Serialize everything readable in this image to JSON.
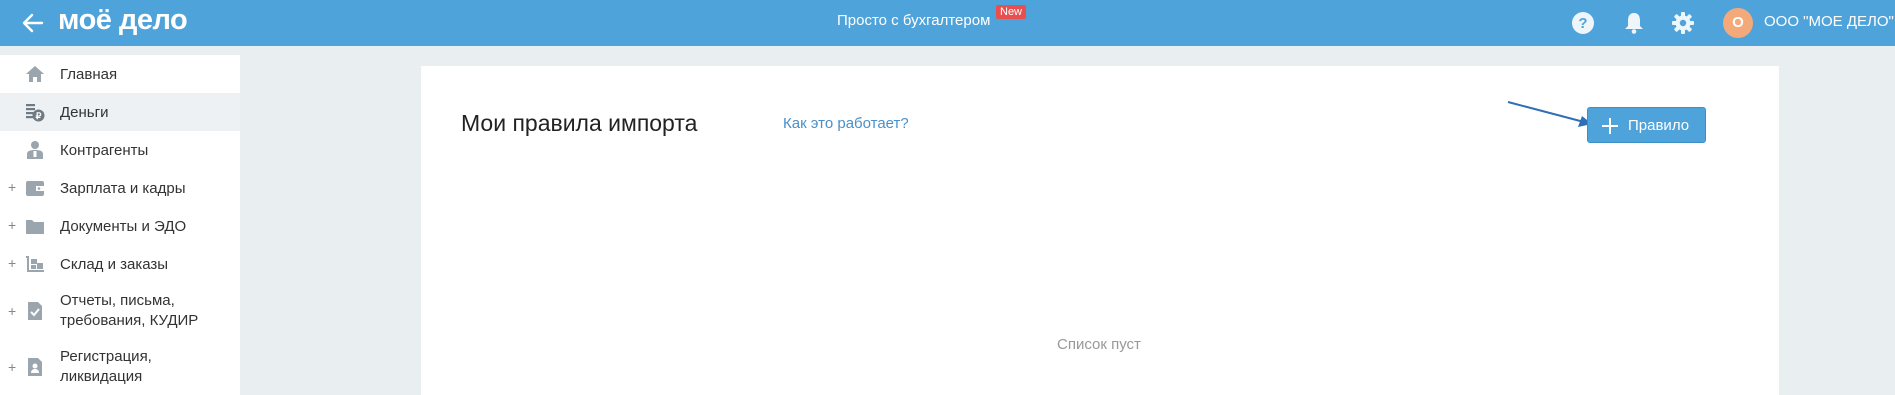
{
  "header": {
    "logo": "моё дело",
    "center_link": "Просто с бухгалтером",
    "new_badge": "New",
    "avatar_letter": "О",
    "org_name": "ООО \"МОЕ ДЕЛО\"",
    "icons": [
      "back-arrow-icon",
      "help-icon",
      "bell-icon",
      "gear-icon"
    ],
    "accent_color": "#4fa3db"
  },
  "sidebar": {
    "items": [
      {
        "label": "Главная",
        "icon": "home-icon",
        "expandable": false,
        "active": false
      },
      {
        "label": "Деньги",
        "icon": "money-icon",
        "expandable": false,
        "active": true
      },
      {
        "label": "Контрагенты",
        "icon": "contractors-icon",
        "expandable": false,
        "active": false
      },
      {
        "label": "Зарплата и кадры",
        "icon": "wallet-icon",
        "expandable": true,
        "active": false
      },
      {
        "label": "Документы и ЭДО",
        "icon": "folder-icon",
        "expandable": true,
        "active": false
      },
      {
        "label": "Склад и заказы",
        "icon": "warehouse-icon",
        "expandable": true,
        "active": false
      },
      {
        "label": "Отчеты, письма,\nтребования, КУДИР",
        "label_line1": "Отчеты, письма,",
        "label_line2": "требования, КУДИР",
        "icon": "report-icon",
        "expandable": true,
        "active": false
      },
      {
        "label": "Регистрация,\nликвидация",
        "label_line1": "Регистрация,",
        "label_line2": "ликвидация",
        "icon": "registration-icon",
        "expandable": true,
        "active": false
      }
    ],
    "expand_symbol": "+"
  },
  "main": {
    "title": "Мои правила импорта",
    "how_link": "Как это работает?",
    "add_button_label": "Правило",
    "empty_text": "Список пуст"
  }
}
